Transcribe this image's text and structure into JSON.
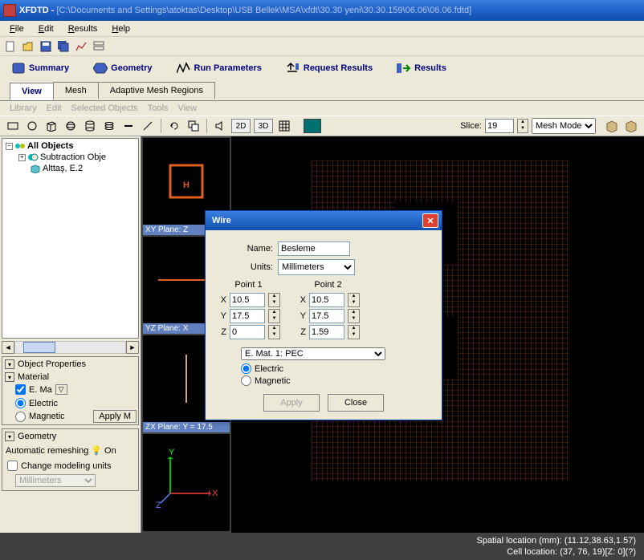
{
  "title": {
    "app": "XFDTD",
    "path": "[C:\\Documents and Settings\\atoktas\\Desktop\\USB Bellek\\MSA\\xfdt\\30.30 yeni\\30.30.159\\06.06\\06.06.fdtd]"
  },
  "menu": {
    "file": "File",
    "edit": "Edit",
    "results": "Results",
    "help": "Help"
  },
  "main_tabs": {
    "summary": "Summary",
    "geometry": "Geometry",
    "run": "Run Parameters",
    "request": "Request Results",
    "results": "Results"
  },
  "sub_tabs": {
    "view": "View",
    "mesh": "Mesh",
    "adaptive": "Adaptive Mesh Regions"
  },
  "sub_menu": {
    "library": "Library",
    "edit": "Edit",
    "selected": "Selected Objects",
    "tools": "Tools",
    "view": "View"
  },
  "shape_bar": {
    "dim2d": "2D",
    "dim3d": "3D",
    "slice_label": "Slice:",
    "slice_value": "19",
    "mesh_mode": "Mesh Mode"
  },
  "tree": {
    "root": "All Objects",
    "sub": "Subtraction Obje",
    "item": "Alttaş, E.2"
  },
  "props": {
    "header": "Object Properties",
    "material": "Material",
    "mat_value": "E. Ma",
    "electric": "Electric",
    "magnetic": "Magnetic",
    "apply": "Apply M"
  },
  "geom": {
    "header": "Geometry",
    "remesh": "Automatic remeshing",
    "remesh_state": "On",
    "change_units": "Change modeling units",
    "units": "Millimeters"
  },
  "thumbs": {
    "xy": "XY Plane: Z",
    "yz": "YZ Plane: X",
    "zx": "ZX Plane: Y = 17.5"
  },
  "status": {
    "spatial": "Spatial location (mm): (11.12,38.63,1.57)",
    "cell": "Cell location: (37, 76, 19)[Z: 0](?)"
  },
  "dialog": {
    "title": "Wire",
    "name_label": "Name:",
    "name_value": "Besleme",
    "units_label": "Units:",
    "units_value": "Millimeters",
    "p1": "Point 1",
    "p2": "Point 2",
    "x": "X",
    "y": "Y",
    "z": "Z",
    "p1x": "10.5",
    "p1y": "17.5",
    "p1z": "0",
    "p2x": "10.5",
    "p2y": "17.5",
    "p2z": "1.59",
    "mat": "E. Mat. 1: PEC",
    "electric": "Electric",
    "magnetic": "Magnetic",
    "apply": "Apply",
    "close": "Close"
  }
}
